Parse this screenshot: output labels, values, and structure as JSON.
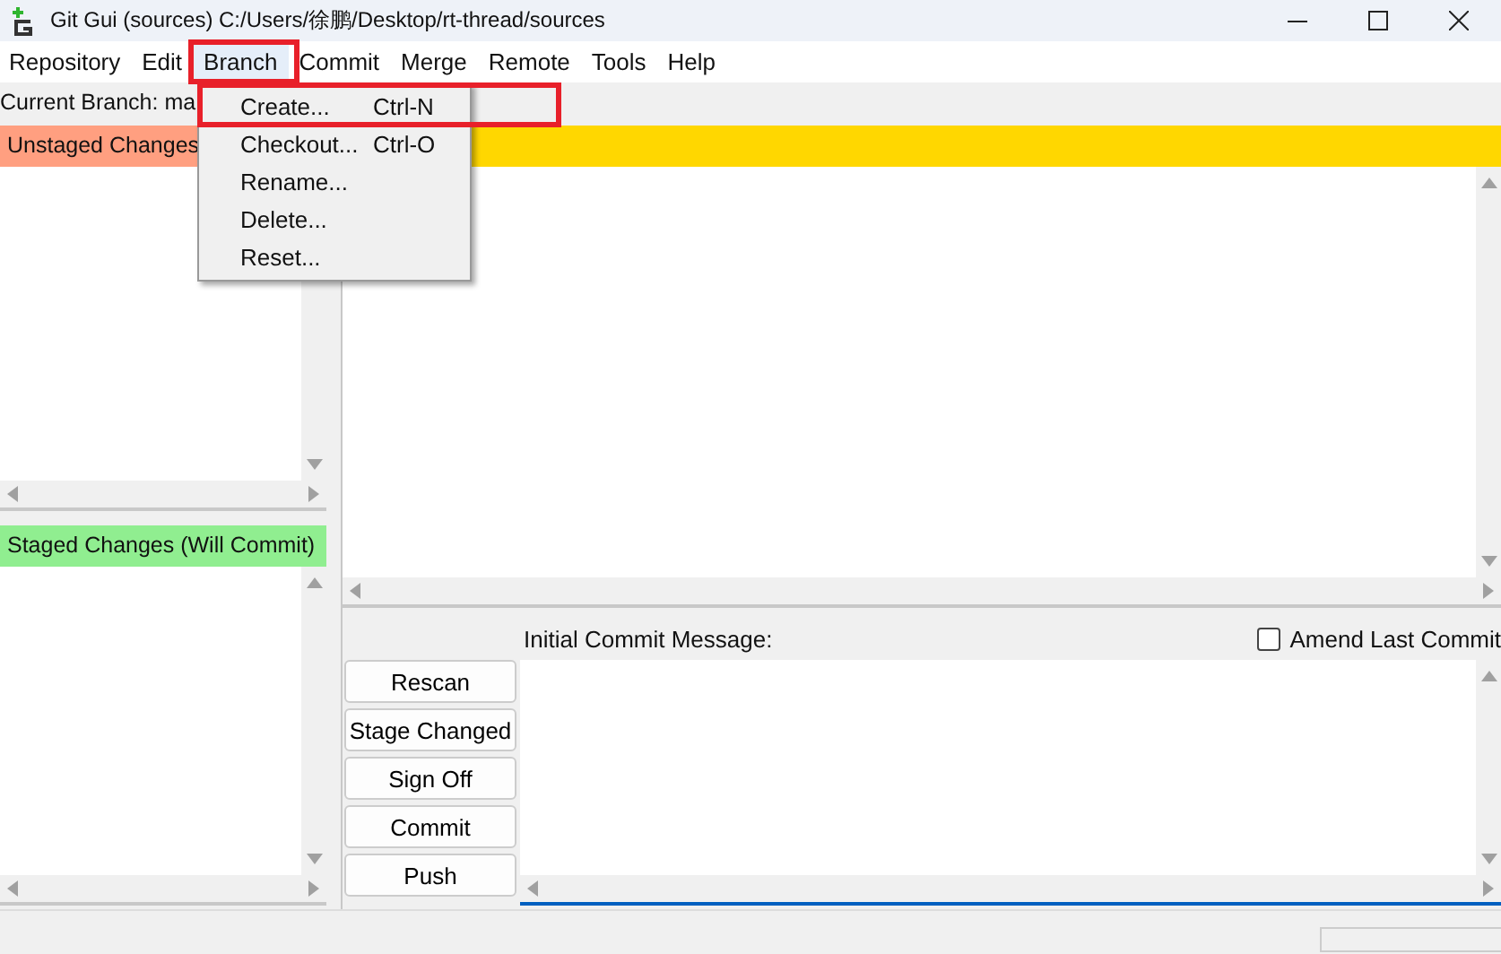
{
  "window": {
    "title": "Git Gui (sources) C:/Users/徐鹏/Desktop/rt-thread/sources"
  },
  "menu_bar": [
    {
      "label": "Repository",
      "selected": false
    },
    {
      "label": "Edit",
      "selected": false
    },
    {
      "label": "Branch",
      "selected": true
    },
    {
      "label": "Commit",
      "selected": false
    },
    {
      "label": "Merge",
      "selected": false
    },
    {
      "label": "Remote",
      "selected": false
    },
    {
      "label": "Tools",
      "selected": false
    },
    {
      "label": "Help",
      "selected": false
    }
  ],
  "branch_menu": [
    {
      "label": "Create...",
      "shortcut": "Ctrl-N"
    },
    {
      "label": "Checkout...",
      "shortcut": "Ctrl-O"
    },
    {
      "label": "Rename..."
    },
    {
      "label": "Delete..."
    },
    {
      "label": "Reset..."
    }
  ],
  "current_branch": "Current Branch: ma",
  "unstaged": {
    "title": "Unstaged Changes"
  },
  "staged": {
    "title": "Staged Changes (Will Commit)"
  },
  "commit": {
    "label": "Initial Commit Message:",
    "amend": {
      "label": "Amend Last Commit",
      "checked": false
    }
  },
  "buttons": [
    "Rescan",
    "Stage Changed",
    "Sign Off",
    "Commit",
    "Push"
  ]
}
